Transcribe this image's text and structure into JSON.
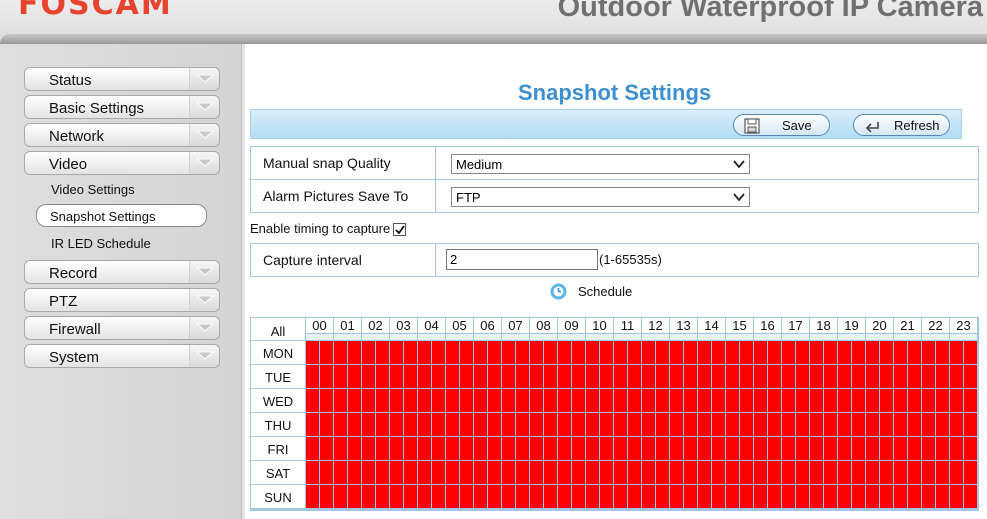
{
  "header": {
    "logo": "FOSCAM",
    "product_title": "Outdoor Waterproof IP Camera"
  },
  "sidebar": {
    "items": [
      {
        "label": "Status"
      },
      {
        "label": "Basic Settings"
      },
      {
        "label": "Network"
      },
      {
        "label": "Video"
      },
      {
        "label": "Record"
      },
      {
        "label": "PTZ"
      },
      {
        "label": "Firewall"
      },
      {
        "label": "System"
      }
    ],
    "video_sub": [
      {
        "label": "Video Settings"
      },
      {
        "label": "Snapshot Settings",
        "active": true
      },
      {
        "label": "IR LED Schedule"
      }
    ]
  },
  "page": {
    "title": "Snapshot Settings",
    "save_label": "Save",
    "refresh_label": "Refresh"
  },
  "form": {
    "quality_label": "Manual snap Quality",
    "quality_value": "Medium",
    "save_to_label": "Alarm Pictures Save To",
    "save_to_value": "FTP",
    "enable_label": "Enable timing to capture",
    "enable_checked": true,
    "interval_label": "Capture interval",
    "interval_value": "2",
    "interval_hint": "(1-65535s)",
    "schedule_label": "Schedule"
  },
  "schedule": {
    "all_label": "All",
    "hours": [
      "00",
      "01",
      "02",
      "03",
      "04",
      "05",
      "06",
      "07",
      "08",
      "09",
      "10",
      "11",
      "12",
      "13",
      "14",
      "15",
      "16",
      "17",
      "18",
      "19",
      "20",
      "21",
      "22",
      "23"
    ],
    "days": [
      "MON",
      "TUE",
      "WED",
      "THU",
      "FRI",
      "SAT",
      "SUN"
    ],
    "active_color": "#ff0000",
    "all_slots_selected": true
  },
  "colors": {
    "accent": "#3d8fcf",
    "logo": "#e8432e"
  }
}
